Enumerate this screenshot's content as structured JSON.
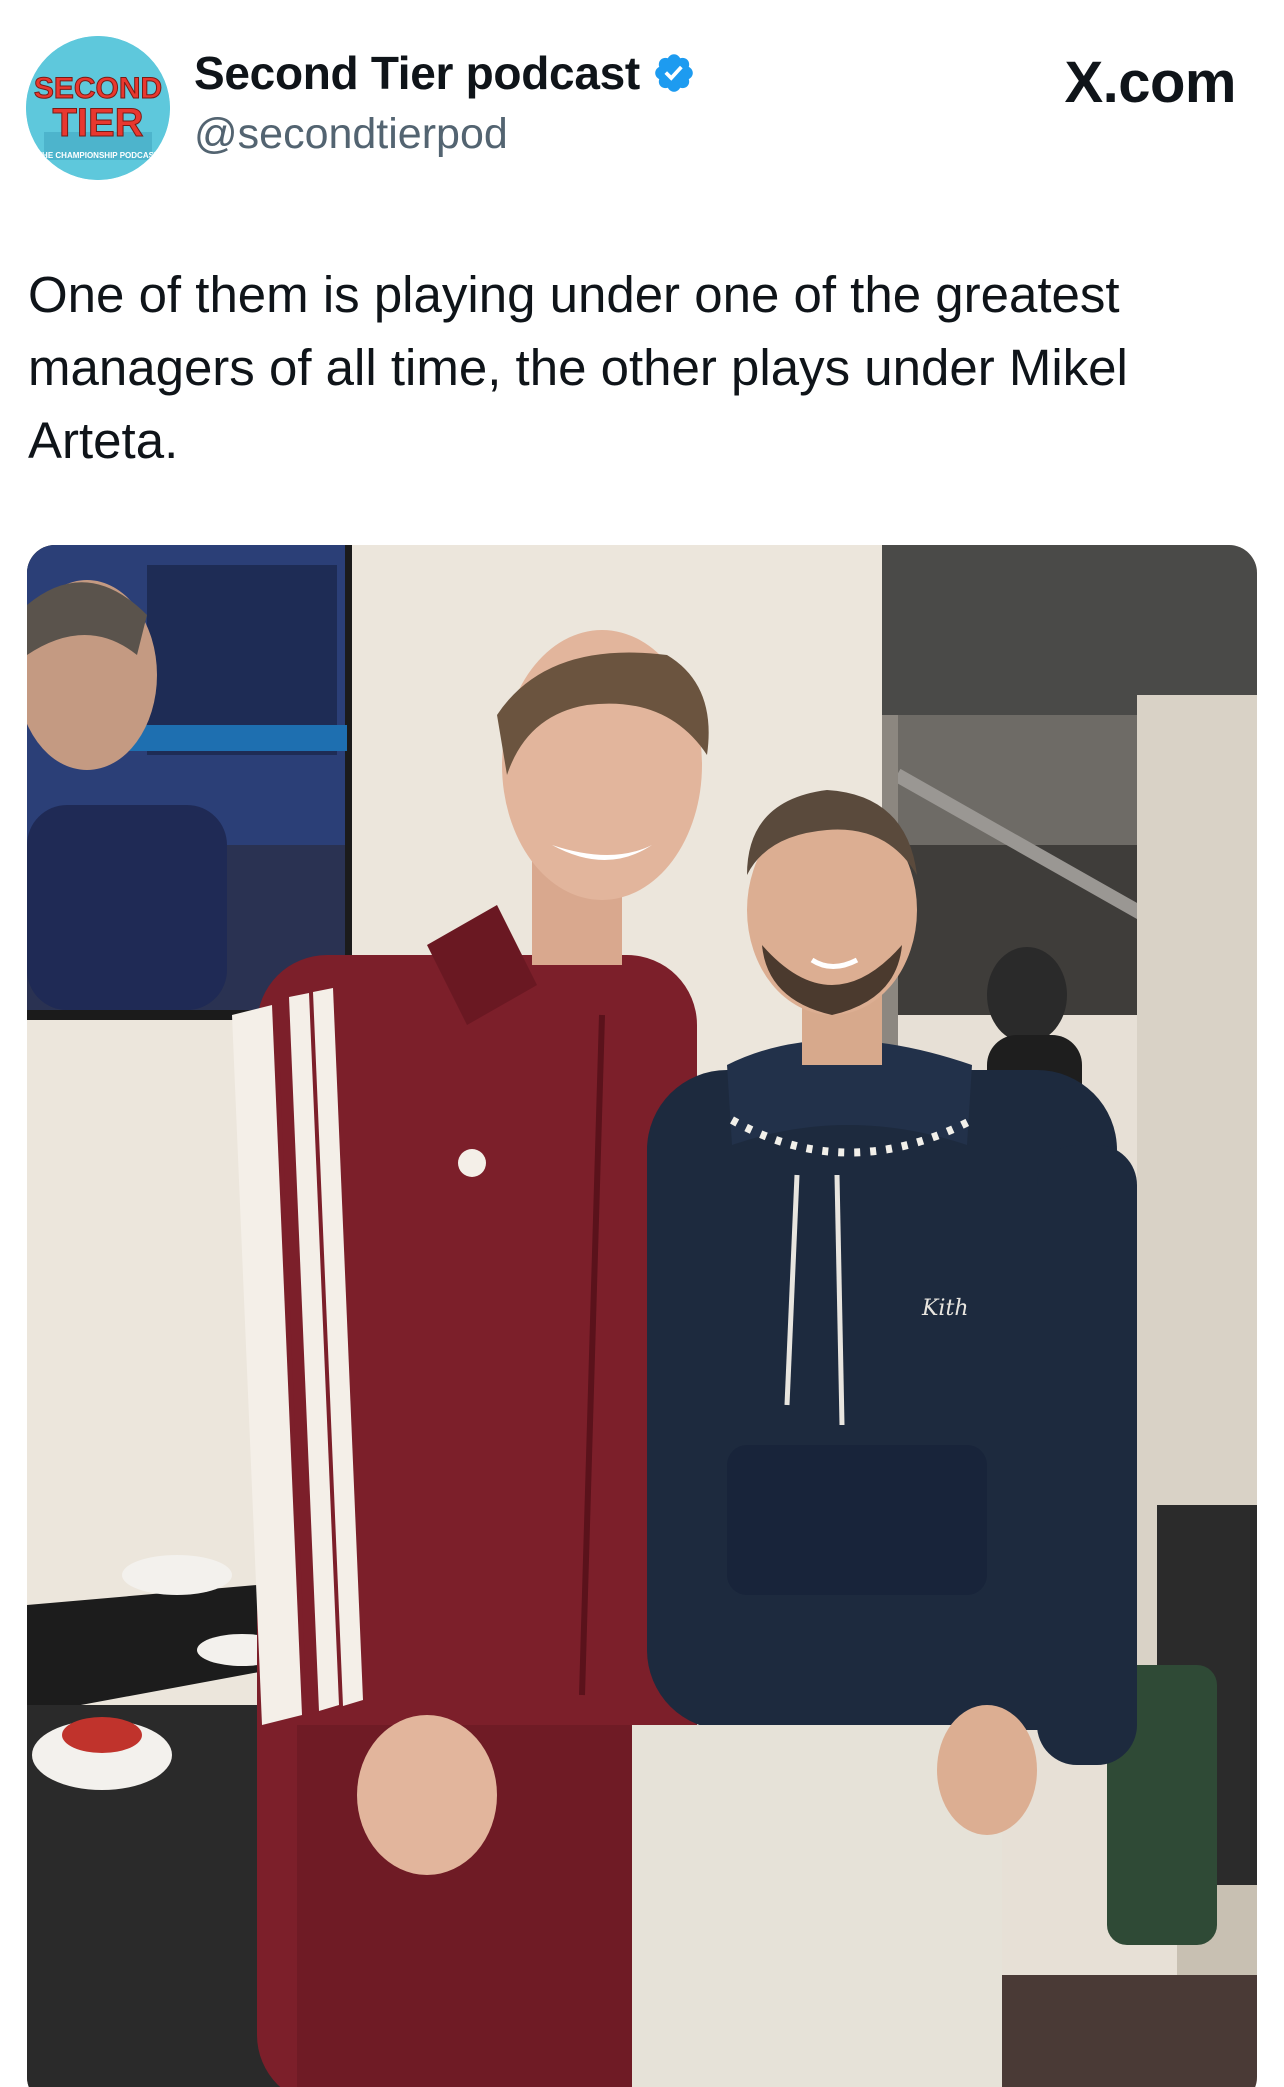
{
  "account": {
    "display_name": "Second Tier podcast",
    "handle": "@secondtierpod",
    "avatar_text_line1": "SECOND",
    "avatar_text_line2": "TIER",
    "avatar_caption": "THE CHAMPIONSHIP PODCAST",
    "verified": true
  },
  "site": {
    "label": "X.com"
  },
  "tweet": {
    "text": "One of them is playing under one of the greatest managers of all time, the other plays under Mikel Arteta."
  },
  "media": {
    "type": "photo"
  },
  "colors": {
    "verified_blue": "#1d9bf0",
    "handle_gray": "#536471",
    "avatar_bg": "#5ec8dc",
    "avatar_text": "#e8382f",
    "maroon_tracksuit": "#7c1f2a",
    "navy_hoodie": "#1d2a3e"
  }
}
